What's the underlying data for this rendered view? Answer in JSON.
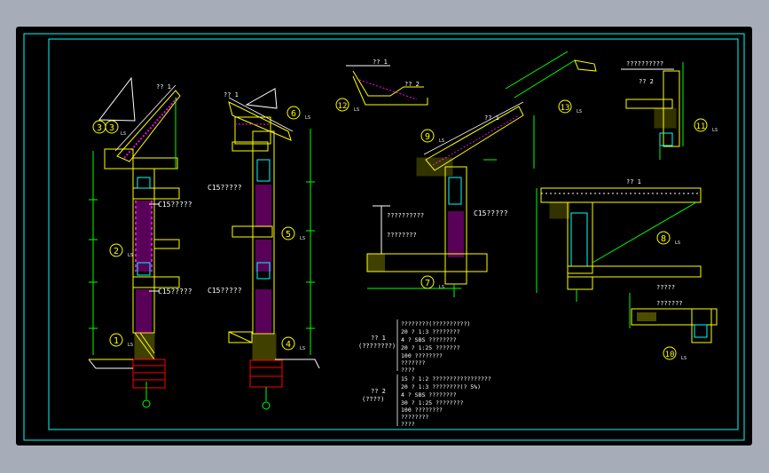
{
  "colors": {
    "background": "#000000",
    "frame_outer": "#a7adb8",
    "border": "#00ffff",
    "structure": "#ffff00",
    "dimension": "#00ff00",
    "hatch": "#ff00ff",
    "text": "#ffffff",
    "grid_line": "#ff0000",
    "accent_cyan": "#00ffff"
  },
  "details": [
    {
      "number": "1",
      "suffix": "LS"
    },
    {
      "number": "2",
      "suffix": "LS"
    },
    {
      "number": "3",
      "suffix": "LS",
      "second": "3"
    },
    {
      "number": "4",
      "suffix": "LS"
    },
    {
      "number": "5",
      "suffix": "LS"
    },
    {
      "number": "6",
      "suffix": "LS"
    },
    {
      "number": "7",
      "suffix": "LS"
    },
    {
      "number": "8",
      "suffix": "LS"
    },
    {
      "number": "9",
      "suffix": "LS"
    },
    {
      "number": "10",
      "suffix": "LS"
    },
    {
      "number": "11",
      "suffix": "LS"
    },
    {
      "number": "12",
      "suffix": "LS"
    },
    {
      "number": "13",
      "suffix": "LS"
    }
  ],
  "labels": {
    "roof_1a": "?? 1",
    "roof_1b": "?? 1",
    "roof_1c": "?? 1",
    "roof_1d": "?? 1",
    "roof_1e": "?? 1",
    "roof_2a": "?? 2",
    "roof_2b": "?? 2",
    "c15_top_a": "C15?????",
    "c15_bot_a": "C15?????",
    "c15_top_b": "C15?????",
    "c15_bot_b": "C15?????",
    "c15_right": "C15?????",
    "parapet_top": "??????????",
    "parapet_mid": "????????",
    "note_right_top": "??????????",
    "note_right_bottom": "?????",
    "note_box": "???????"
  },
  "notes": {
    "block1_title": "?? 1",
    "block1_sub": "(????????)",
    "block1_lines": [
      "????????(??????????)",
      "20 ? 1:3 ????????",
      "4 ? SBS ????????",
      "20 ? 1:25 ???????",
      "100 ????????",
      "???????",
      "????"
    ],
    "block2_title": "?? 2",
    "block2_sub": "(????)",
    "block2_lines": [
      "15 ? 1:2 ?????????????????",
      "20 ? 1:3 ????????(? 5%)",
      "4 ? SBS ????????",
      "30 ? 1:25 ????????",
      "100 ????????",
      "????????",
      "????"
    ]
  }
}
